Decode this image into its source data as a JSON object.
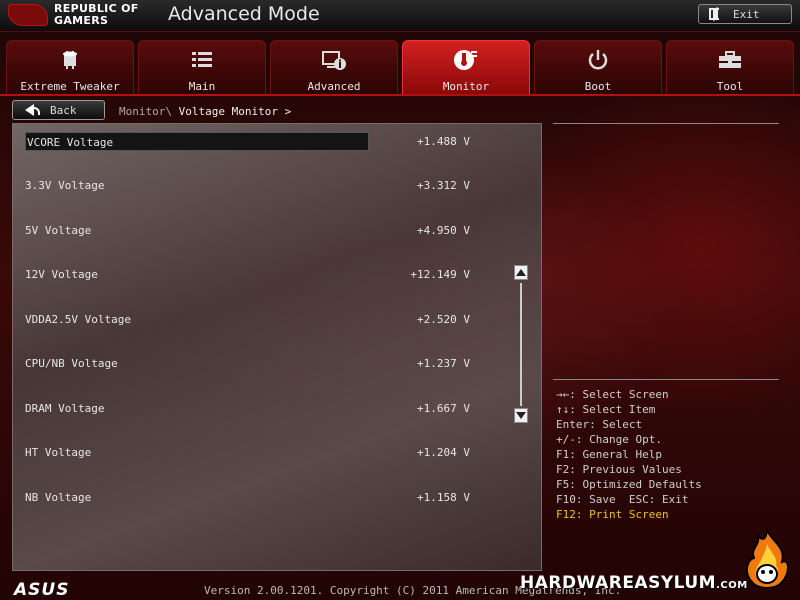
{
  "header": {
    "brand_line1": "REPUBLIC OF",
    "brand_line2": "GAMERS",
    "title": "Advanced Mode",
    "exit_label": "Exit"
  },
  "tabs": [
    {
      "label": "Extreme Tweaker",
      "icon": "cpu-chip-icon",
      "active": false
    },
    {
      "label": "Main",
      "icon": "list-icon",
      "active": false
    },
    {
      "label": "Advanced",
      "icon": "monitor-info-icon",
      "active": false
    },
    {
      "label": "Monitor",
      "icon": "thermometer-icon",
      "active": true
    },
    {
      "label": "Boot",
      "icon": "power-icon",
      "active": false
    },
    {
      "label": "Tool",
      "icon": "toolbox-icon",
      "active": false
    }
  ],
  "nav": {
    "back_label": "Back",
    "breadcrumb_root": "Monitor\\",
    "breadcrumb_current": "Voltage Monitor >"
  },
  "voltages": [
    {
      "label": "VCORE Voltage",
      "value": "+1.488 V",
      "selected": true
    },
    {
      "label": "3.3V Voltage",
      "value": "+3.312 V"
    },
    {
      "label": "5V Voltage",
      "value": "+4.950 V"
    },
    {
      "label": "12V Voltage",
      "value": "+12.149 V"
    },
    {
      "label": "VDDA2.5V Voltage",
      "value": "+2.520 V"
    },
    {
      "label": "CPU/NB Voltage",
      "value": "+1.237 V"
    },
    {
      "label": "DRAM Voltage",
      "value": "+1.667 V"
    },
    {
      "label": "HT Voltage",
      "value": "+1.204 V"
    },
    {
      "label": "NB Voltage",
      "value": "+1.158 V"
    }
  ],
  "help": [
    "→←: Select Screen",
    "↑↓: Select Item",
    "Enter: Select",
    "+/-: Change Opt.",
    "F1: General Help",
    "F2: Previous Values",
    "F5: Optimized Defaults",
    "F10: Save  ESC: Exit",
    "F12: Print Screen"
  ],
  "footer": {
    "logo": "ASUS",
    "version": "Version 2.00.1201. Copyright (C) 2011 American Megatrends, Inc.",
    "watermark": "HARDWAREASYLUM",
    "watermark_suffix": ".COM"
  },
  "colors": {
    "accent": "#d42020",
    "highlight": "#f0c020"
  }
}
